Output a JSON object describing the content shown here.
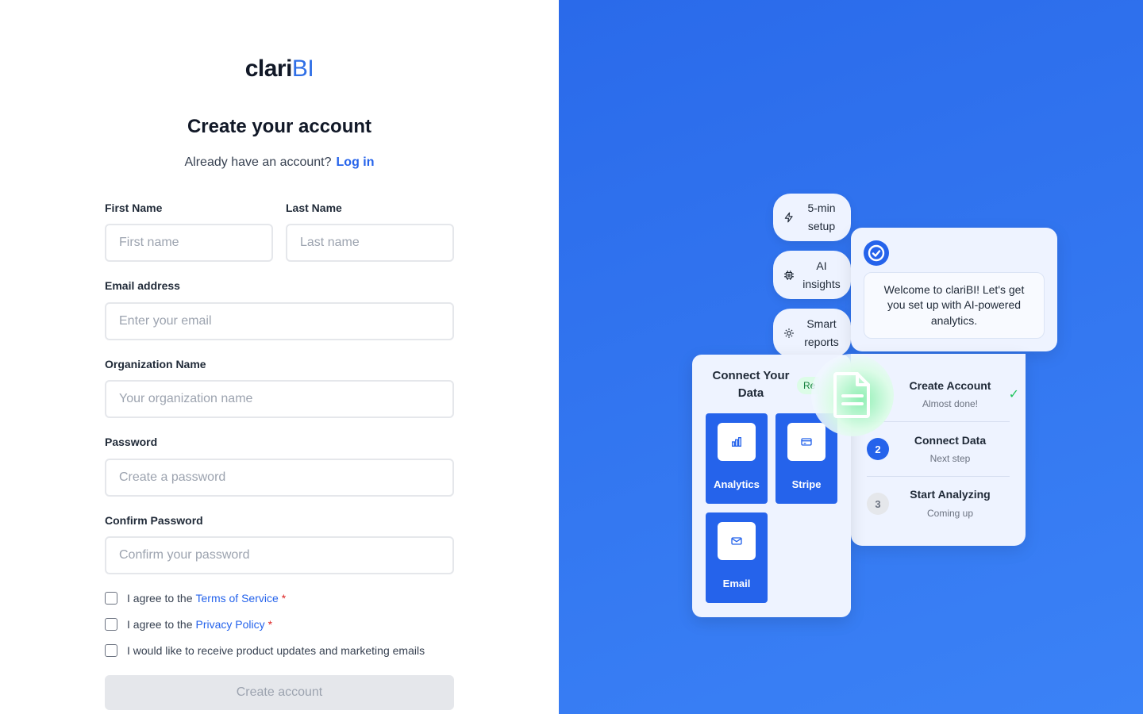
{
  "brand": {
    "logo_dark": "clari",
    "logo_blue": "BI"
  },
  "header": {
    "title": "Create your account",
    "subtitle": "Already have an account?",
    "login_link": "Log in"
  },
  "form": {
    "first_name": {
      "label": "First Name",
      "placeholder": "First name",
      "value": ""
    },
    "last_name": {
      "label": "Last Name",
      "placeholder": "Last name",
      "value": ""
    },
    "email": {
      "label": "Email address",
      "placeholder": "Enter your email",
      "value": ""
    },
    "organization": {
      "label": "Organization Name",
      "placeholder": "Your organization name",
      "value": ""
    },
    "password": {
      "label": "Password",
      "placeholder": "Create a password",
      "value": ""
    },
    "confirm_password": {
      "label": "Confirm Password",
      "placeholder": "Confirm your password",
      "value": ""
    },
    "terms": {
      "prefix": "I agree to the",
      "link": "Terms of Service",
      "required": "*",
      "checked": false
    },
    "privacy": {
      "prefix": "I agree to the",
      "link": "Privacy Policy",
      "required": "*",
      "checked": false
    },
    "marketing": {
      "text": "I would like to receive product updates and marketing emails",
      "checked": false
    },
    "submit_label": "Create account"
  },
  "illustration": {
    "features": [
      {
        "icon": "lightning-icon",
        "line1": "5-min",
        "line2": "setup"
      },
      {
        "icon": "cpu-chip-icon",
        "line1": "AI",
        "line2": "insights"
      },
      {
        "icon": "lightbulb-icon",
        "line1": "Smart",
        "line2": "reports"
      }
    ],
    "welcome_message": "Welcome to clariBI! Let's get you set up with AI-powered analytics.",
    "steps": [
      {
        "number": "",
        "title": "Create Account",
        "status": "Almost done!",
        "done_mark": "✓"
      },
      {
        "number": "2",
        "title": "Connect Data",
        "status": "Next step"
      },
      {
        "number": "3",
        "title": "Start Analyzing",
        "status": "Coming up"
      }
    ],
    "connect": {
      "title_line1": "Connect Your",
      "title_line2": "Data",
      "badge": "Re",
      "sources": [
        "Analytics",
        "Stripe",
        "Email"
      ]
    }
  },
  "colors": {
    "accent": "#2563eb",
    "panel_bg": "#2a6aea",
    "success": "#22c55e",
    "required": "#dc2626"
  }
}
